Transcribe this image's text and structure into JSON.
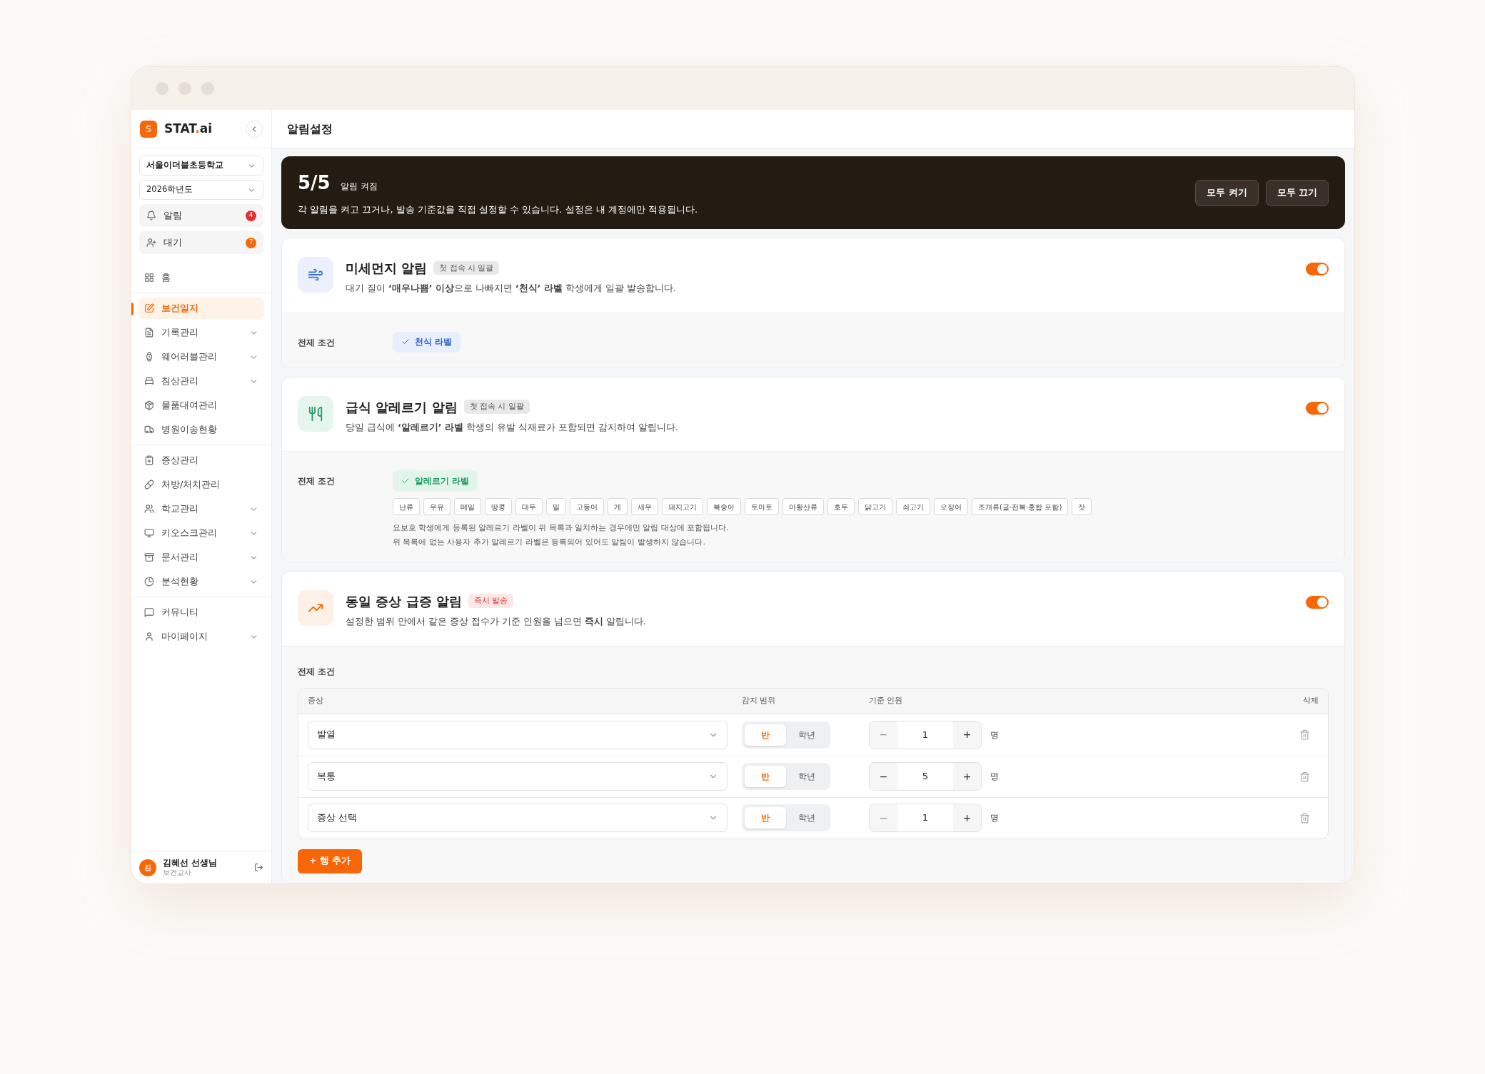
{
  "brand": {
    "logo": "S",
    "name_main": "STAT",
    "name_dot": ".",
    "name_rest": "ai"
  },
  "sidebar": {
    "selects": [
      "서울이더블초등학교",
      "2026학년도"
    ],
    "quick": [
      {
        "label": "알림",
        "count": "4",
        "color": "#e03131"
      },
      {
        "label": "대기",
        "count": "7",
        "color": "#f76707"
      }
    ],
    "groups": [
      [
        {
          "label": "홈",
          "selected": false,
          "expandable": false
        }
      ],
      [
        {
          "label": "보건일지",
          "selected": true,
          "expandable": false
        },
        {
          "label": "기록관리",
          "selected": false,
          "expandable": true
        },
        {
          "label": "웨어러블관리",
          "selected": false,
          "expandable": true
        },
        {
          "label": "침상관리",
          "selected": false,
          "expandable": true
        },
        {
          "label": "물품대여관리",
          "selected": false,
          "expandable": false
        },
        {
          "label": "병원이송현황",
          "selected": false,
          "expandable": false
        }
      ],
      [
        {
          "label": "증상관리",
          "selected": false,
          "expandable": false
        },
        {
          "label": "처방/처치관리",
          "selected": false,
          "expandable": false
        },
        {
          "label": "학교관리",
          "selected": false,
          "expandable": true
        },
        {
          "label": "키오스크관리",
          "selected": false,
          "expandable": true
        },
        {
          "label": "문서관리",
          "selected": false,
          "expandable": true
        },
        {
          "label": "분석현황",
          "selected": false,
          "expandable": true
        }
      ],
      [
        {
          "label": "커뮤니티",
          "selected": false,
          "expandable": false
        },
        {
          "label": "마이페이지",
          "selected": false,
          "expandable": true
        }
      ]
    ],
    "user": {
      "initial": "김",
      "name": "김혜선 선생님",
      "role": "보건교사"
    }
  },
  "page_title": "알림설정",
  "banner": {
    "count": "5/5",
    "count_label": "알림 켜짐",
    "description": "각 알림을 켜고 끄거나, 발송 기준값을 직접 설정할 수 있습니다. 설정은 내 계정에만 적용됩니다.",
    "buttons": [
      "모두 켜기",
      "모두 끄기"
    ]
  },
  "cards": [
    {
      "kind": "dust",
      "title": "미세먼지 알림",
      "badge": "첫 접속 시 일괄",
      "description": "대기 질이 **‘매우나쁨’ 이상**으로 나빠지면 **‘천식’ 라벨** 학생에게 일괄 발송합니다.",
      "on": true,
      "condition_label": "전제 조건",
      "condition_chip": "천식 라벨"
    },
    {
      "kind": "allergy",
      "title": "급식 알레르기 알림",
      "badge": "첫 접속 시 일괄",
      "description": "당일 급식에 **‘알레르기’ 라벨** 학생의 유발 식재료가 포함되면 감지하여 알립니다.",
      "on": true,
      "condition_label": "전제 조건",
      "condition_chip": "알레르기 라벨",
      "allergens": [
        "난류",
        "우유",
        "메밀",
        "땅콩",
        "대두",
        "밀",
        "고등어",
        "게",
        "새우",
        "돼지고기",
        "복숭아",
        "토마토",
        "아황산류",
        "호두",
        "닭고기",
        "쇠고기",
        "오징어",
        "조개류(굴·전복·홍합 포함)",
        "잣"
      ],
      "notes": [
        "요보호 학생에게 등록된 알레르기 라벨이 위 목록과 일치하는 경우에만 알림 대상에 포함됩니다.",
        "위 목록에 없는 사용자 추가 알레르기 라벨은 등록되어 있어도 알림이 발생하지 않습니다."
      ]
    },
    {
      "kind": "surge",
      "title": "동일 증상 급증 알림",
      "badge": "즉시 발송",
      "description": "설정한 범위 안에서 같은 증상 접수가 기준 인원을 넘으면 **즉시** 알립니다.",
      "on": true,
      "condition_label": "전제 조건",
      "table": {
        "columns": [
          "증상",
          "감지 범위",
          "기준 인원",
          "삭제"
        ],
        "rows": [
          {
            "symptom": "발열",
            "scopes": [
              {
                "label": "반",
                "selected": true
              },
              {
                "label": "학년",
                "selected": false
              }
            ],
            "minus": "−",
            "value": "1",
            "plus": "+",
            "minus_disabled": true,
            "unit": "명"
          },
          {
            "symptom": "복통",
            "scopes": [
              {
                "label": "반",
                "selected": true
              },
              {
                "label": "학년",
                "selected": false
              }
            ],
            "minus": "−",
            "value": "5",
            "plus": "+",
            "minus_disabled": false,
            "unit": "명"
          },
          {
            "symptom": "증상 선택",
            "scopes": [
              {
                "label": "반",
                "selected": true
              },
              {
                "label": "학년",
                "selected": false
              }
            ],
            "minus": "−",
            "value": "1",
            "plus": "+",
            "minus_disabled": true,
            "unit": "명"
          }
        ]
      },
      "add_button": "+ 행 추가"
    }
  ]
}
